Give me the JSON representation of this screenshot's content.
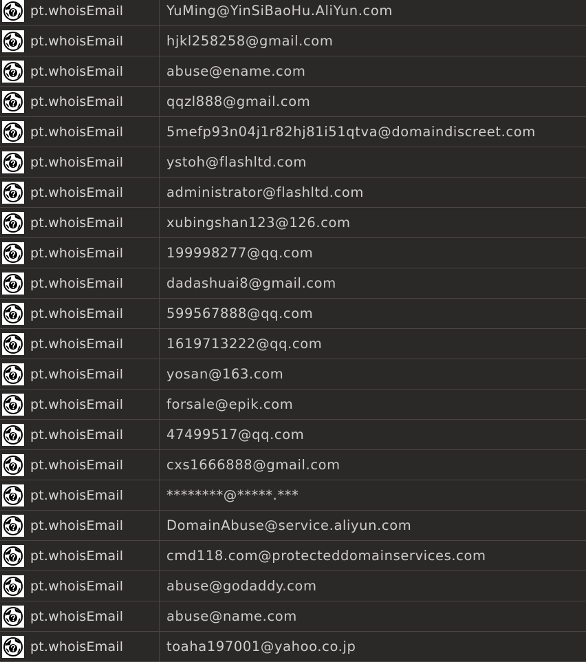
{
  "theme": {
    "background": "#2b2828",
    "grid_line": "#4a4646",
    "text": "#cfcccc",
    "icon_bg": "#ffffff",
    "icon_fg": "#000000"
  },
  "rows": [
    {
      "icon": "globe-question-icon",
      "type": "pt.whoisEmail",
      "value": "YuMing@YinSiBaoHu.AliYun.com"
    },
    {
      "icon": "globe-question-icon",
      "type": "pt.whoisEmail",
      "value": "hjkl258258@gmail.com"
    },
    {
      "icon": "globe-question-icon",
      "type": "pt.whoisEmail",
      "value": "abuse@ename.com"
    },
    {
      "icon": "globe-question-icon",
      "type": "pt.whoisEmail",
      "value": "qqzl888@gmail.com"
    },
    {
      "icon": "globe-question-icon",
      "type": "pt.whoisEmail",
      "value": "5mefp93n04j1r82hj81i51qtva@domaindiscreet.com"
    },
    {
      "icon": "globe-question-icon",
      "type": "pt.whoisEmail",
      "value": "ystoh@flashltd.com"
    },
    {
      "icon": "globe-question-icon",
      "type": "pt.whoisEmail",
      "value": "administrator@flashltd.com"
    },
    {
      "icon": "globe-question-icon",
      "type": "pt.whoisEmail",
      "value": "xubingshan123@126.com"
    },
    {
      "icon": "globe-question-icon",
      "type": "pt.whoisEmail",
      "value": "199998277@qq.com"
    },
    {
      "icon": "globe-question-icon",
      "type": "pt.whoisEmail",
      "value": "dadashuai8@gmail.com"
    },
    {
      "icon": "globe-question-icon",
      "type": "pt.whoisEmail",
      "value": "599567888@qq.com"
    },
    {
      "icon": "globe-question-icon",
      "type": "pt.whoisEmail",
      "value": "1619713222@qq.com"
    },
    {
      "icon": "globe-question-icon",
      "type": "pt.whoisEmail",
      "value": "yosan@163.com"
    },
    {
      "icon": "globe-question-icon",
      "type": "pt.whoisEmail",
      "value": "forsale@epik.com"
    },
    {
      "icon": "globe-question-icon",
      "type": "pt.whoisEmail",
      "value": "47499517@qq.com"
    },
    {
      "icon": "globe-question-icon",
      "type": "pt.whoisEmail",
      "value": "cxs1666888@gmail.com"
    },
    {
      "icon": "globe-question-icon",
      "type": "pt.whoisEmail",
      "value": "********@*****.***"
    },
    {
      "icon": "globe-question-icon",
      "type": "pt.whoisEmail",
      "value": "DomainAbuse@service.aliyun.com"
    },
    {
      "icon": "globe-question-icon",
      "type": "pt.whoisEmail",
      "value": "cmd118.com@protecteddomainservices.com"
    },
    {
      "icon": "globe-question-icon",
      "type": "pt.whoisEmail",
      "value": "abuse@godaddy.com"
    },
    {
      "icon": "globe-question-icon",
      "type": "pt.whoisEmail",
      "value": "abuse@name.com"
    },
    {
      "icon": "globe-question-icon",
      "type": "pt.whoisEmail",
      "value": "toaha197001@yahoo.co.jp"
    }
  ]
}
